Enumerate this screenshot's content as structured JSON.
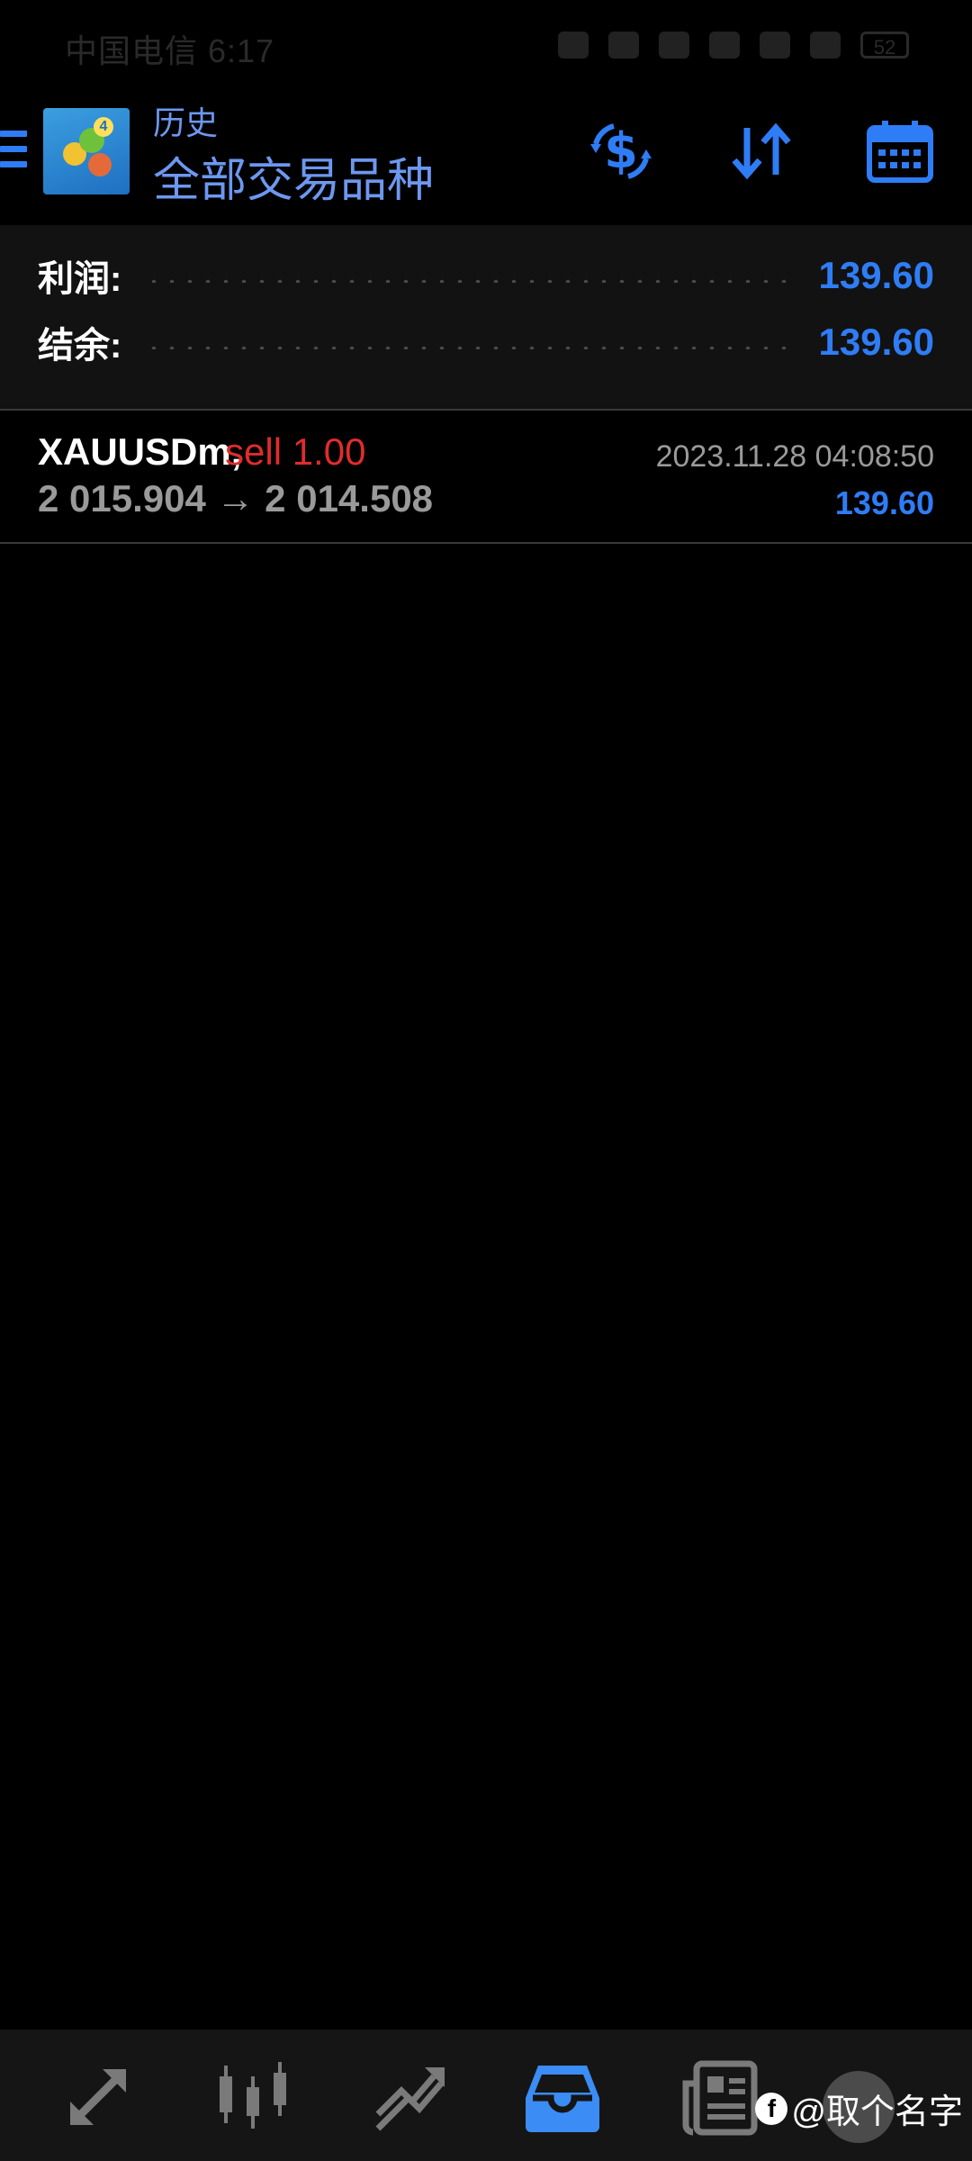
{
  "status_bar": {
    "carrier_time": "中国电信 6:17",
    "battery": "52"
  },
  "header": {
    "subtitle": "历史",
    "title": "全部交易品种",
    "icons": [
      "menu-icon",
      "app-logo",
      "currency-exchange-icon",
      "sort-icon",
      "calendar-icon"
    ],
    "accent_color": "#2f7df6"
  },
  "summary": {
    "profit_label": "利润:",
    "profit_value": "139.60",
    "balance_label": "结余:",
    "balance_value": "139.60"
  },
  "trades": [
    {
      "symbol": "XAUUSDm,",
      "type": "sell 1.00",
      "prices": "2 015.904 → 2 014.508",
      "time": "2023.11.28 04:08:50",
      "profit": "139.60"
    }
  ],
  "bottom_nav": {
    "items": [
      "trade-icon",
      "chart-icon",
      "analytics-icon",
      "history-icon",
      "news-icon"
    ],
    "active": "history-icon",
    "watermark_text": "@取个名字"
  }
}
